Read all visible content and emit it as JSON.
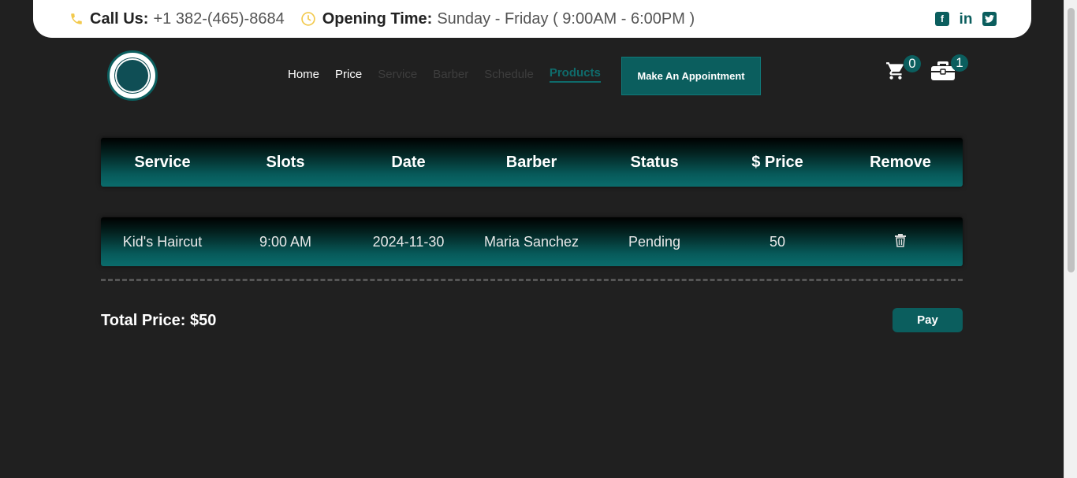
{
  "topbar": {
    "call_label": "Call Us:",
    "call_value": "+1 382-(465)-8684",
    "hours_label": "Opening Time:",
    "hours_value": "Sunday - Friday ( 9:00AM - 6:00PM )",
    "socials": [
      "facebook-icon",
      "linkedin-icon",
      "twitter-icon"
    ]
  },
  "nav": {
    "items": [
      {
        "label": "Home",
        "state": "normal"
      },
      {
        "label": "Price",
        "state": "normal"
      },
      {
        "label": "Service",
        "state": "dim"
      },
      {
        "label": "Barber",
        "state": "dim"
      },
      {
        "label": "Schedule",
        "state": "dim"
      },
      {
        "label": "Products",
        "state": "active"
      }
    ],
    "appointment_button": "Make An Appointment",
    "cart_count": "0",
    "bag_count": "1"
  },
  "table": {
    "headers": [
      "Service",
      "Slots",
      "Date",
      "Barber",
      "Status",
      "$ Price",
      "Remove"
    ],
    "rows": [
      {
        "service": "Kid's Haircut",
        "slot": "9:00 AM",
        "date": "2024-11-30",
        "barber": "Maria Sanchez",
        "status": "Pending",
        "price": "50"
      }
    ]
  },
  "total": {
    "text": "Total Price: $50"
  },
  "pay_button": "Pay",
  "colors": {
    "accent": "#0b5e5e",
    "background": "#202020",
    "clock": "#f2c94c"
  }
}
